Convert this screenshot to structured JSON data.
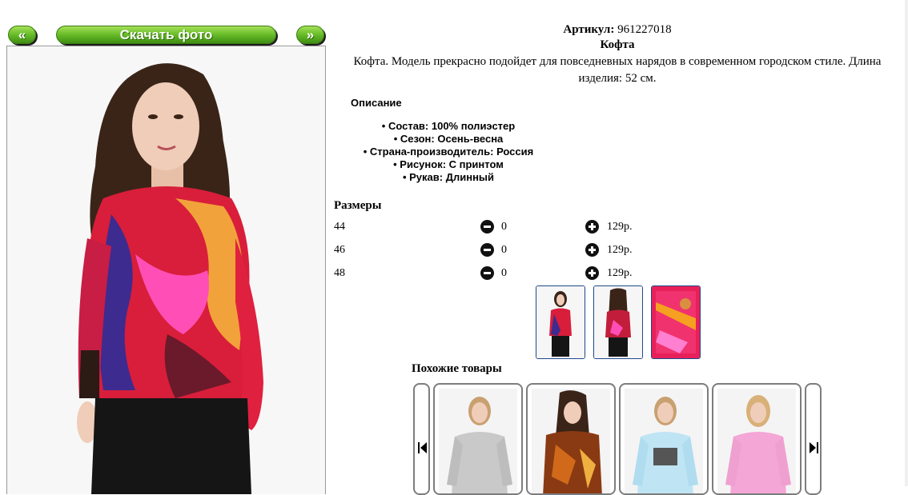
{
  "toolbar": {
    "prev_label": "«",
    "download_label": "Скачать фото",
    "next_label": "»",
    "button_color": "#6cbf2b"
  },
  "product": {
    "sku_label": "Артикул:",
    "sku_value": "961227018",
    "name": "Кофта",
    "description": "Кофта. Модель прекрасно подойдет для повседневных нарядов в современном городском стиле. Длина изделия: 52 см."
  },
  "specs": {
    "title": "Описание",
    "items": [
      "Состав: 100% полиэстер",
      "Сезон: Осень-весна",
      "Страна-производитель: Россия",
      "Рисунок: С принтом",
      "Рукав: Длинный"
    ]
  },
  "sizes": {
    "title": "Размеры",
    "rows": [
      {
        "size": "44",
        "qty": "0",
        "price": "129р."
      },
      {
        "size": "46",
        "qty": "0",
        "price": "129р."
      },
      {
        "size": "48",
        "qty": "0",
        "price": "129р."
      }
    ]
  },
  "thumbnails": [
    "front-view",
    "back-view",
    "print-detail"
  ],
  "similar": {
    "title": "Похожие товары",
    "items": [
      "grey-sweatshirt",
      "brown-print-blouse",
      "light-blue-top",
      "pink-top"
    ]
  },
  "icons": {
    "minus": "minus-circle-icon",
    "plus": "plus-circle-icon",
    "carousel_prev": "skip-back-icon",
    "carousel_next": "skip-forward-icon"
  }
}
